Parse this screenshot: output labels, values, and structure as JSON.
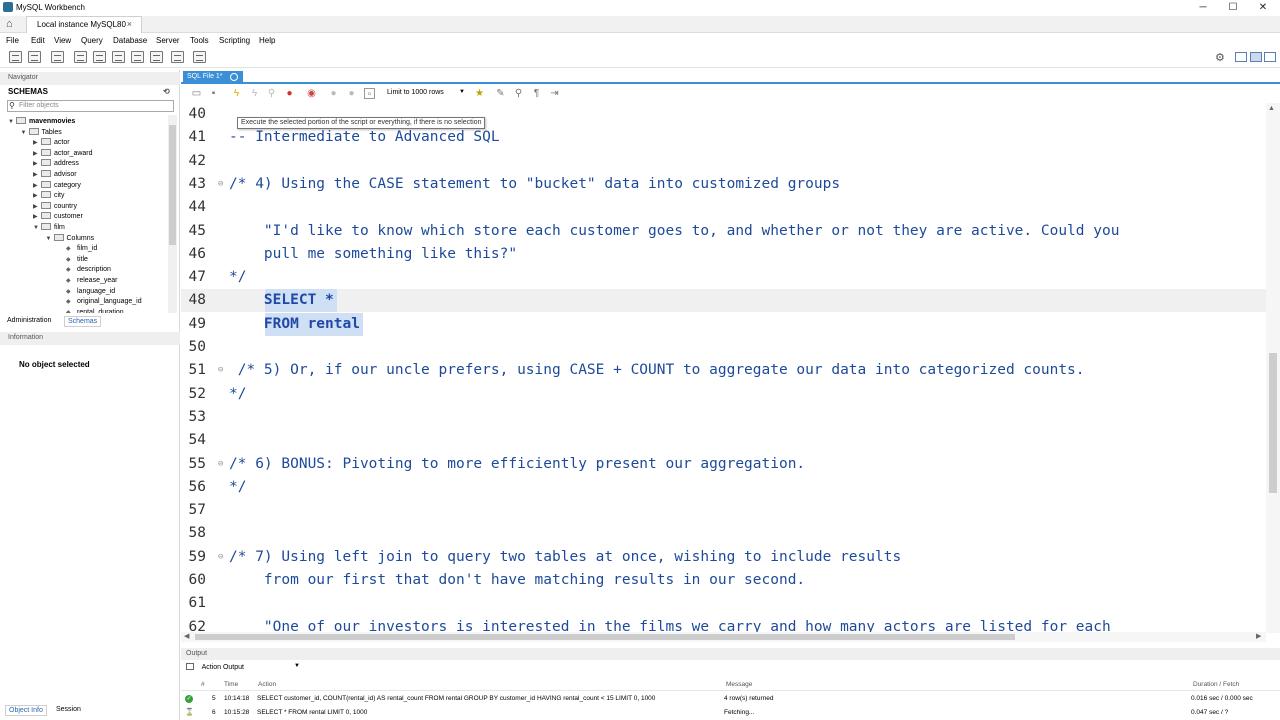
{
  "window": {
    "title": "MySQL Workbench",
    "minimize": "─",
    "maximize": "☐",
    "close": "✕"
  },
  "connection_tab": {
    "home_icon": "⌂",
    "label": "Local instance MySQL80",
    "close": "×"
  },
  "menu": [
    "File",
    "Edit",
    "View",
    "Query",
    "Database",
    "Server",
    "Tools",
    "Scripting",
    "Help"
  ],
  "sidebar": {
    "navigator_label": "Navigator",
    "schemas_label": "SCHEMAS",
    "filter_placeholder": "Filter objects",
    "tree": [
      {
        "label": "mavenmovies",
        "level": 0,
        "arrow": "▼",
        "kind": "db",
        "bold": true
      },
      {
        "label": "Tables",
        "level": 1,
        "arrow": "▼",
        "kind": "folder"
      },
      {
        "label": "actor",
        "level": 2,
        "arrow": "▶",
        "kind": "table"
      },
      {
        "label": "actor_award",
        "level": 2,
        "arrow": "▶",
        "kind": "table"
      },
      {
        "label": "address",
        "level": 2,
        "arrow": "▶",
        "kind": "table"
      },
      {
        "label": "advisor",
        "level": 2,
        "arrow": "▶",
        "kind": "table"
      },
      {
        "label": "category",
        "level": 2,
        "arrow": "▶",
        "kind": "table"
      },
      {
        "label": "city",
        "level": 2,
        "arrow": "▶",
        "kind": "table"
      },
      {
        "label": "country",
        "level": 2,
        "arrow": "▶",
        "kind": "table"
      },
      {
        "label": "customer",
        "level": 2,
        "arrow": "▶",
        "kind": "table"
      },
      {
        "label": "film",
        "level": 2,
        "arrow": "▼",
        "kind": "table"
      },
      {
        "label": "Columns",
        "level": 3,
        "arrow": "▼",
        "kind": "folder"
      },
      {
        "label": "film_id",
        "level": 4,
        "arrow": "",
        "kind": "column"
      },
      {
        "label": "title",
        "level": 4,
        "arrow": "",
        "kind": "column"
      },
      {
        "label": "description",
        "level": 4,
        "arrow": "",
        "kind": "column"
      },
      {
        "label": "release_year",
        "level": 4,
        "arrow": "",
        "kind": "column"
      },
      {
        "label": "language_id",
        "level": 4,
        "arrow": "",
        "kind": "column"
      },
      {
        "label": "original_language_id",
        "level": 4,
        "arrow": "",
        "kind": "column"
      },
      {
        "label": "rental_duration",
        "level": 4,
        "arrow": "",
        "kind": "column"
      }
    ],
    "tabs": {
      "administration": "Administration",
      "schemas": "Schemas"
    },
    "information_label": "Information",
    "no_object": "No object selected",
    "bottom_tabs": {
      "object_info": "Object Info",
      "session": "Session"
    }
  },
  "editor_tab": {
    "label": "SQL File 1*"
  },
  "sql_toolbar": {
    "limit_label": "Limit to 1000 rows"
  },
  "tooltip": "Execute the selected portion of the script or everything, if there is no selection",
  "editor": {
    "lines": [
      {
        "num": "40",
        "fold": "",
        "text": ""
      },
      {
        "num": "41",
        "fold": "",
        "text": "-- Intermediate to Advanced SQL"
      },
      {
        "num": "42",
        "fold": "",
        "text": ""
      },
      {
        "num": "43",
        "fold": "⊖",
        "text": "/* 4) Using the CASE statement to \"bucket\" data into customized groups"
      },
      {
        "num": "44",
        "fold": "",
        "text": ""
      },
      {
        "num": "45",
        "fold": "",
        "text": "    \"I'd like to know which store each customer goes to, and whether or not they are active. Could you"
      },
      {
        "num": "46",
        "fold": "",
        "text": "    pull me something like this?\""
      },
      {
        "num": "47",
        "fold": "",
        "text": "*/"
      },
      {
        "num": "48",
        "fold": "",
        "text": "    SELECT *",
        "selected": true,
        "current": true
      },
      {
        "num": "49",
        "fold": "",
        "text": "    FROM rental",
        "selected": true
      },
      {
        "num": "50",
        "fold": "",
        "text": ""
      },
      {
        "num": "51",
        "fold": "⊖",
        "text": " /* 5) Or, if our uncle prefers, using CASE + COUNT to aggregate our data into categorized counts."
      },
      {
        "num": "52",
        "fold": "",
        "text": "*/"
      },
      {
        "num": "53",
        "fold": "",
        "text": ""
      },
      {
        "num": "54",
        "fold": "",
        "text": ""
      },
      {
        "num": "55",
        "fold": "⊖",
        "text": "/* 6) BONUS: Pivoting to more efficiently present our aggregation."
      },
      {
        "num": "56",
        "fold": "",
        "text": "*/"
      },
      {
        "num": "57",
        "fold": "",
        "text": ""
      },
      {
        "num": "58",
        "fold": "",
        "text": ""
      },
      {
        "num": "59",
        "fold": "⊖",
        "text": "/* 7) Using left join to query two tables at once, wishing to include results"
      },
      {
        "num": "60",
        "fold": "",
        "text": "    from our first that don't have matching results in our second."
      },
      {
        "num": "61",
        "fold": "",
        "text": ""
      },
      {
        "num": "62",
        "fold": "",
        "text": "    \"One of our investors is interested in the films we carry and how many actors are listed for each"
      }
    ]
  },
  "output": {
    "header": "Output",
    "selector": "Action Output",
    "columns": {
      "num": "#",
      "time": "Time",
      "action": "Action",
      "message": "Message",
      "duration": "Duration / Fetch"
    },
    "rows": [
      {
        "status": "ok",
        "num": "5",
        "time": "10:14:18",
        "action": "SELECT customer_id,      COUNT(rental_id) AS rental_count FROM rental     GROUP BY customer_id HAVING rental_count < 15 LIMIT 0, 1000",
        "message": "4 row(s) returned",
        "duration": "0.016 sec / 0.000 sec"
      },
      {
        "status": "running",
        "num": "6",
        "time": "10:15:28",
        "action": "SELECT *      FROM rental LIMIT 0, 1000",
        "message": "Fetching...",
        "duration": "0.047 sec / ?"
      }
    ]
  },
  "colors": {
    "accent": "#3b8fd6",
    "selection": "#cfe0f4",
    "code": "#1e4a9a"
  }
}
